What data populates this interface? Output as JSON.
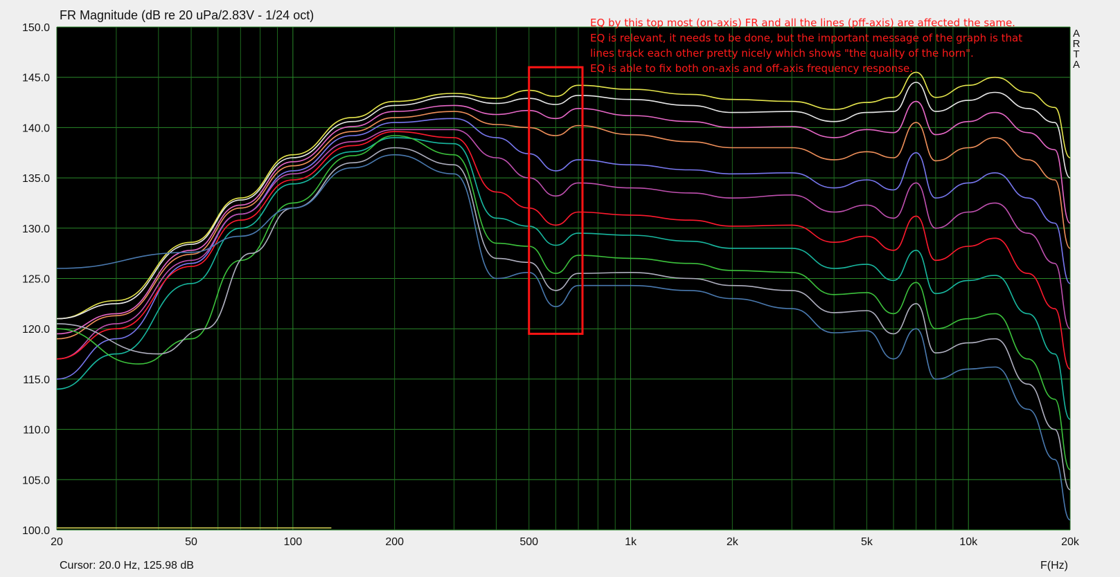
{
  "chart_data": {
    "type": "line",
    "title": "FR Magnitude (dB re 20 uPa/2.83V - 1/24 oct)",
    "xlabel": "F(Hz)",
    "ylabel": "",
    "x_scale": "log",
    "xlim": [
      20,
      20000
    ],
    "ylim": [
      100,
      150
    ],
    "grid": true,
    "background": "#000000",
    "y_ticks": [
      "150.0",
      "145.0",
      "140.0",
      "135.0",
      "130.0",
      "125.0",
      "120.0",
      "115.0",
      "110.0",
      "105.0",
      "100.0"
    ],
    "y_tick_values": [
      150,
      145,
      140,
      135,
      130,
      125,
      120,
      115,
      110,
      105,
      100
    ],
    "x_tick_labels": [
      "20",
      "50",
      "100",
      "200",
      "500",
      "1k",
      "2k",
      "5k",
      "10k",
      "20k"
    ],
    "x_tick_values": [
      20,
      50,
      100,
      200,
      500,
      1000,
      2000,
      5000,
      10000,
      20000
    ],
    "cursor": "Cursor: 20.0 Hz, 125.98 dB",
    "brand_letters": [
      "A",
      "R",
      "T",
      "A"
    ],
    "annotation_lines": [
      "EQ by this top most (on-axis) FR and all the lines (pff-axis) are affected the same.",
      "EQ is relevant, it needs to be done, but the important message of the graph is that",
      "lines track each other pretty nicely which shows \"the quality of the horn\".",
      "EQ is able to fix both on-axis and off-axis frequency response."
    ],
    "highlight_box": {
      "x_range": [
        500,
        720
      ],
      "y_range": [
        119.5,
        146
      ]
    },
    "series": [
      {
        "color": "#e6e64d",
        "points": [
          [
            20,
            121.0
          ],
          [
            30,
            122.8
          ],
          [
            50,
            128.6
          ],
          [
            70,
            133.0
          ],
          [
            100,
            137.3
          ],
          [
            150,
            141.0
          ],
          [
            200,
            142.6
          ],
          [
            300,
            143.4
          ],
          [
            400,
            142.9
          ],
          [
            500,
            143.7
          ],
          [
            600,
            143.1
          ],
          [
            700,
            144.2
          ],
          [
            1000,
            143.8
          ],
          [
            1500,
            143.3
          ],
          [
            2000,
            142.8
          ],
          [
            3000,
            142.6
          ],
          [
            4000,
            141.8
          ],
          [
            5000,
            142.5
          ],
          [
            6000,
            143.0
          ],
          [
            7000,
            145.5
          ],
          [
            8000,
            143.0
          ],
          [
            10000,
            144.2
          ],
          [
            12000,
            145.0
          ],
          [
            15000,
            143.5
          ],
          [
            18000,
            142.0
          ],
          [
            20000,
            137.0
          ]
        ]
      },
      {
        "color": "#e8e8e8",
        "points": [
          [
            20,
            121.0
          ],
          [
            30,
            122.5
          ],
          [
            50,
            128.4
          ],
          [
            70,
            132.8
          ],
          [
            100,
            137.0
          ],
          [
            150,
            140.6
          ],
          [
            200,
            142.2
          ],
          [
            300,
            143.1
          ],
          [
            400,
            142.4
          ],
          [
            500,
            142.9
          ],
          [
            600,
            142.3
          ],
          [
            700,
            143.2
          ],
          [
            1000,
            142.8
          ],
          [
            1500,
            142.2
          ],
          [
            2000,
            141.5
          ],
          [
            3000,
            141.6
          ],
          [
            4000,
            140.6
          ],
          [
            5000,
            141.5
          ],
          [
            6000,
            141.6
          ],
          [
            7000,
            144.5
          ],
          [
            8000,
            141.6
          ],
          [
            10000,
            142.7
          ],
          [
            12000,
            143.5
          ],
          [
            15000,
            141.9
          ],
          [
            18000,
            140.5
          ],
          [
            20000,
            135.0
          ]
        ]
      },
      {
        "color": "#e868c8",
        "points": [
          [
            20,
            119.5
          ],
          [
            30,
            121.5
          ],
          [
            50,
            127.8
          ],
          [
            70,
            132.3
          ],
          [
            100,
            136.6
          ],
          [
            150,
            140.1
          ],
          [
            200,
            141.6
          ],
          [
            300,
            142.2
          ],
          [
            400,
            141.3
          ],
          [
            500,
            141.7
          ],
          [
            600,
            140.9
          ],
          [
            700,
            141.9
          ],
          [
            1000,
            141.2
          ],
          [
            1500,
            140.6
          ],
          [
            2000,
            140.0
          ],
          [
            3000,
            140.1
          ],
          [
            4000,
            139.0
          ],
          [
            5000,
            139.8
          ],
          [
            6000,
            139.5
          ],
          [
            7000,
            142.6
          ],
          [
            8000,
            139.3
          ],
          [
            10000,
            140.6
          ],
          [
            12000,
            141.5
          ],
          [
            15000,
            139.5
          ],
          [
            18000,
            137.8
          ],
          [
            20000,
            130.5
          ]
        ]
      },
      {
        "color": "#f0905a",
        "points": [
          [
            20,
            119.0
          ],
          [
            30,
            121.3
          ],
          [
            50,
            127.4
          ],
          [
            70,
            132.0
          ],
          [
            100,
            136.2
          ],
          [
            150,
            139.6
          ],
          [
            200,
            141.0
          ],
          [
            300,
            141.6
          ],
          [
            400,
            140.3
          ],
          [
            500,
            140.0
          ],
          [
            600,
            139.2
          ],
          [
            700,
            140.2
          ],
          [
            1000,
            139.3
          ],
          [
            1500,
            138.6
          ],
          [
            2000,
            138.0
          ],
          [
            3000,
            138.0
          ],
          [
            4000,
            136.8
          ],
          [
            5000,
            137.6
          ],
          [
            6000,
            137.0
          ],
          [
            7000,
            140.5
          ],
          [
            8000,
            136.7
          ],
          [
            10000,
            138.0
          ],
          [
            12000,
            139.0
          ],
          [
            15000,
            136.8
          ],
          [
            18000,
            134.8
          ],
          [
            20000,
            128.0
          ]
        ]
      },
      {
        "color": "#7878f0",
        "points": [
          [
            20,
            115.0
          ],
          [
            30,
            119.0
          ],
          [
            50,
            126.5
          ],
          [
            70,
            131.4
          ],
          [
            100,
            135.7
          ],
          [
            150,
            139.2
          ],
          [
            200,
            140.5
          ],
          [
            300,
            140.9
          ],
          [
            400,
            139.0
          ],
          [
            500,
            137.4
          ],
          [
            600,
            135.7
          ],
          [
            700,
            136.8
          ],
          [
            1000,
            136.3
          ],
          [
            1500,
            135.8
          ],
          [
            2000,
            135.4
          ],
          [
            3000,
            135.5
          ],
          [
            4000,
            134.0
          ],
          [
            5000,
            134.8
          ],
          [
            6000,
            133.8
          ],
          [
            7000,
            137.5
          ],
          [
            8000,
            133.0
          ],
          [
            10000,
            134.5
          ],
          [
            12000,
            135.5
          ],
          [
            15000,
            133.0
          ],
          [
            18000,
            130.5
          ],
          [
            20000,
            124.5
          ]
        ]
      },
      {
        "color": "#c050b0",
        "points": [
          [
            20,
            117.0
          ],
          [
            30,
            120.5
          ],
          [
            50,
            126.8
          ],
          [
            70,
            131.4
          ],
          [
            100,
            135.4
          ],
          [
            150,
            138.6
          ],
          [
            200,
            139.8
          ],
          [
            300,
            139.8
          ],
          [
            400,
            137.0
          ],
          [
            500,
            135.0
          ],
          [
            600,
            133.2
          ],
          [
            700,
            134.5
          ],
          [
            1000,
            134.0
          ],
          [
            1500,
            133.5
          ],
          [
            2000,
            133.0
          ],
          [
            3000,
            133.3
          ],
          [
            4000,
            131.6
          ],
          [
            5000,
            132.3
          ],
          [
            6000,
            131.0
          ],
          [
            7000,
            134.5
          ],
          [
            8000,
            130.0
          ],
          [
            10000,
            131.6
          ],
          [
            12000,
            132.5
          ],
          [
            15000,
            129.5
          ],
          [
            18000,
            126.5
          ],
          [
            20000,
            120.0
          ]
        ]
      },
      {
        "color": "#ff1a2e",
        "points": [
          [
            20,
            117.0
          ],
          [
            30,
            120.0
          ],
          [
            50,
            126.2
          ],
          [
            70,
            130.8
          ],
          [
            100,
            134.8
          ],
          [
            150,
            138.2
          ],
          [
            200,
            139.6
          ],
          [
            300,
            139.0
          ],
          [
            400,
            133.6
          ],
          [
            500,
            132.0
          ],
          [
            600,
            130.3
          ],
          [
            700,
            131.6
          ],
          [
            1000,
            131.3
          ],
          [
            1500,
            130.8
          ],
          [
            2000,
            130.2
          ],
          [
            3000,
            130.3
          ],
          [
            4000,
            128.6
          ],
          [
            5000,
            129.2
          ],
          [
            6000,
            127.8
          ],
          [
            7000,
            131.2
          ],
          [
            8000,
            126.8
          ],
          [
            10000,
            128.2
          ],
          [
            12000,
            129.0
          ],
          [
            15000,
            125.5
          ],
          [
            18000,
            122.0
          ],
          [
            20000,
            116.0
          ]
        ]
      },
      {
        "color": "#18b8a0",
        "points": [
          [
            20,
            114.0
          ],
          [
            30,
            117.5
          ],
          [
            50,
            124.5
          ],
          [
            70,
            130.0
          ],
          [
            100,
            134.4
          ],
          [
            150,
            137.6
          ],
          [
            200,
            139.0
          ],
          [
            300,
            138.4
          ],
          [
            400,
            131.0
          ],
          [
            500,
            130.2
          ],
          [
            600,
            128.3
          ],
          [
            700,
            129.5
          ],
          [
            1000,
            129.3
          ],
          [
            1500,
            128.7
          ],
          [
            2000,
            128.0
          ],
          [
            3000,
            128.0
          ],
          [
            4000,
            126.0
          ],
          [
            5000,
            126.4
          ],
          [
            6000,
            124.8
          ],
          [
            7000,
            127.8
          ],
          [
            8000,
            123.5
          ],
          [
            10000,
            124.8
          ],
          [
            12000,
            125.3
          ],
          [
            15000,
            121.5
          ],
          [
            18000,
            117.5
          ],
          [
            20000,
            111.0
          ]
        ]
      },
      {
        "color": "#3cc23c",
        "points": [
          [
            20,
            120.0
          ],
          [
            35,
            116.5
          ],
          [
            50,
            119.0
          ],
          [
            70,
            126.8
          ],
          [
            100,
            132.5
          ],
          [
            150,
            137.2
          ],
          [
            200,
            139.2
          ],
          [
            300,
            137.3
          ],
          [
            400,
            128.5
          ],
          [
            500,
            128.2
          ],
          [
            600,
            125.5
          ],
          [
            700,
            127.3
          ],
          [
            1000,
            127.0
          ],
          [
            1500,
            126.5
          ],
          [
            2000,
            125.8
          ],
          [
            3000,
            125.6
          ],
          [
            4000,
            123.4
          ],
          [
            5000,
            123.6
          ],
          [
            6000,
            121.5
          ],
          [
            7000,
            124.6
          ],
          [
            8000,
            120.0
          ],
          [
            10000,
            121.0
          ],
          [
            12000,
            121.5
          ],
          [
            15000,
            117.0
          ],
          [
            18000,
            113.0
          ],
          [
            20000,
            106.0
          ]
        ]
      },
      {
        "color": "#b0b0c0",
        "points": [
          [
            20,
            120.5
          ],
          [
            40,
            117.5
          ],
          [
            55,
            120.0
          ],
          [
            75,
            127.5
          ],
          [
            100,
            132.0
          ],
          [
            150,
            136.5
          ],
          [
            200,
            138.0
          ],
          [
            300,
            136.3
          ],
          [
            400,
            127.0
          ],
          [
            500,
            126.6
          ],
          [
            600,
            123.8
          ],
          [
            700,
            125.5
          ],
          [
            1000,
            125.6
          ],
          [
            1500,
            125.0
          ],
          [
            2000,
            124.3
          ],
          [
            3000,
            123.8
          ],
          [
            4000,
            121.6
          ],
          [
            5000,
            121.8
          ],
          [
            6000,
            119.5
          ],
          [
            7000,
            122.5
          ],
          [
            8000,
            117.6
          ],
          [
            10000,
            118.6
          ],
          [
            12000,
            119.0
          ],
          [
            15000,
            114.5
          ],
          [
            18000,
            110.0
          ],
          [
            20000,
            104.0
          ]
        ]
      },
      {
        "color": "#4a7ab0",
        "points": [
          [
            20,
            126.0
          ],
          [
            50,
            127.6
          ],
          [
            70,
            129.2
          ],
          [
            100,
            132.0
          ],
          [
            150,
            136.0
          ],
          [
            200,
            137.3
          ],
          [
            300,
            135.4
          ],
          [
            400,
            125.0
          ],
          [
            500,
            125.6
          ],
          [
            600,
            122.2
          ],
          [
            700,
            124.3
          ],
          [
            1000,
            124.3
          ],
          [
            1500,
            123.8
          ],
          [
            2000,
            123.0
          ],
          [
            3000,
            122.0
          ],
          [
            4000,
            119.6
          ],
          [
            5000,
            119.8
          ],
          [
            6000,
            117.0
          ],
          [
            7000,
            120.0
          ],
          [
            8000,
            115.0
          ],
          [
            10000,
            116.0
          ],
          [
            12000,
            116.2
          ],
          [
            15000,
            112.0
          ],
          [
            18000,
            107.0
          ],
          [
            20000,
            101.0
          ]
        ]
      },
      {
        "color": "#c8c850",
        "points": [
          [
            20,
            100.2
          ],
          [
            130,
            100.2
          ]
        ]
      }
    ]
  }
}
